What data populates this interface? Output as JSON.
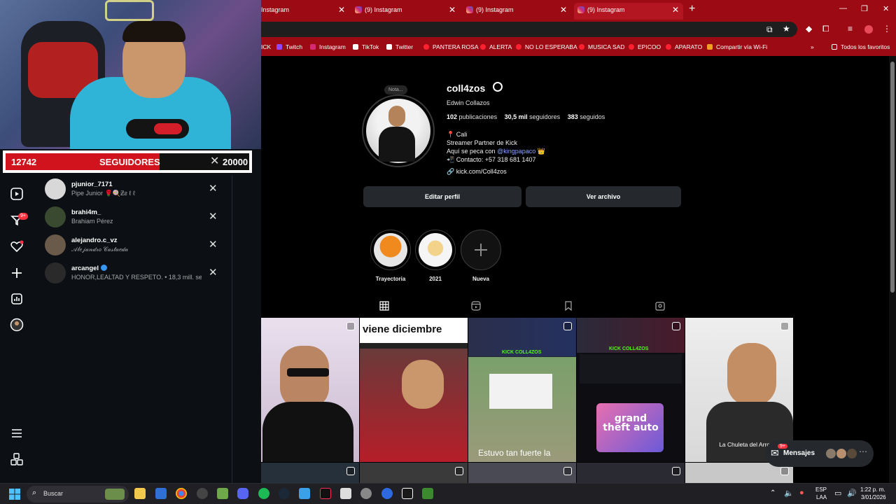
{
  "goal": {
    "current": "12742",
    "label": "SEGUIDORES",
    "target": "20000",
    "progress_fraction": 0.637
  },
  "browser": {
    "tabs": [
      {
        "title": "Instagram",
        "active": false
      },
      {
        "title": "(9) Instagram",
        "active": false
      },
      {
        "title": "(9) Instagram",
        "active": false
      },
      {
        "title": "(9) Instagram",
        "active": true
      }
    ],
    "bookmarks": [
      {
        "label": "ICK",
        "color": "#53fc18"
      },
      {
        "label": "Twitch",
        "color": "#9146ff"
      },
      {
        "label": "Instagram",
        "color": "#d62976"
      },
      {
        "label": "TikTok",
        "color": "#111111"
      },
      {
        "label": "Twitter",
        "color": "#111111"
      },
      {
        "label": "PANTERA ROSA",
        "color": "#ff0000"
      },
      {
        "label": "ALERTA",
        "color": "#ff0000"
      },
      {
        "label": "NO LO ESPERABA",
        "color": "#ff0000"
      },
      {
        "label": "MUSICA SAD",
        "color": "#ff0000"
      },
      {
        "label": "EPICOO",
        "color": "#ff0000"
      },
      {
        "label": "APARATO",
        "color": "#ff0000"
      },
      {
        "label": "Compartir vía Wi-Fi",
        "color": "#f0a020"
      }
    ],
    "all_bookmarks": "Todos los favoritos"
  },
  "follow_list": [
    {
      "username": "pjunior_7171",
      "subtitle": "Pipe Junior 🌹🍭Ƶƨ ℓ ℓ",
      "verified": false
    },
    {
      "username": "brahi4m_",
      "subtitle": "Brahiam Pérez",
      "verified": false
    },
    {
      "username": "alejandro.c_vz",
      "subtitle": "𝒜𝓁𝑒𝒿𝒶𝓃𝒹𝓇𝑜 𝒞𝒶𝓈𝓉𝒶𝑒𝒹𝒶",
      "verified": false
    },
    {
      "username": "arcangel",
      "subtitle": "HONOR,LEALTAD Y RESPETO. • 18,3 mill. segu",
      "verified": true
    }
  ],
  "profile": {
    "note": "Nota...",
    "username": "coll4zos",
    "full_name": "Edwin Collazos",
    "posts_count": "102",
    "posts_label": "publicaciones",
    "followers_count": "30,5 mil",
    "followers_label": "seguidores",
    "following_count": "383",
    "following_label": "seguidos",
    "bio": {
      "location": "📍 Cali",
      "line2": "Streamer Partner de Kick",
      "line3_prefix": "Aquí se peca con ",
      "line3_mention": "@kingpapaco",
      "line3_suffix": " 👑",
      "contact": "📲 Contacto: +57 318 681 1407",
      "link": "kick.com/Coll4zos"
    },
    "edit_button": "Editar perfil",
    "archive_button": "Ver archivo",
    "highlights": [
      {
        "label": "Trayectoria"
      },
      {
        "label": "2021"
      },
      {
        "label": "Nueva"
      }
    ]
  },
  "posts": [
    {
      "caption": ""
    },
    {
      "caption": "viene diciembre"
    },
    {
      "caption": "Estuvo tan fuerte la"
    },
    {
      "caption": "grand theft auto"
    },
    {
      "caption": "La Chuleta del Arroz Chino"
    }
  ],
  "messages": {
    "label": "Mensajes",
    "badge": "9+"
  },
  "notif_badge": "9+",
  "taskbar": {
    "search_placeholder": "Buscar",
    "lang": "ESP",
    "lang2": "LAA",
    "time": "1:22 p. m.",
    "date": "3/01/2026"
  }
}
